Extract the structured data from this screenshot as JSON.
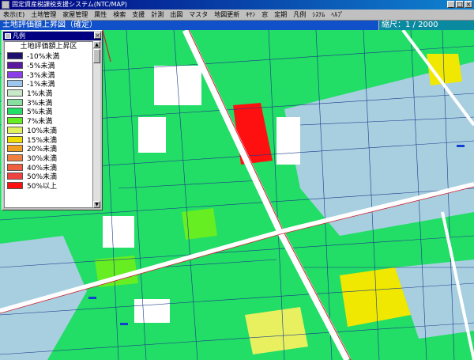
{
  "window": {
    "title": "固定資産税課税支援システム(NTC/MAP)",
    "minimize": "_",
    "maximize": "□",
    "close": "×"
  },
  "menu": [
    "表示(E)",
    "土地管理",
    "家屋管理",
    "属性",
    "検索",
    "支援",
    "計測",
    "出図",
    "マスタ",
    "地図更新",
    "ｷﾔﾝ",
    "窓",
    "定期",
    "凡例",
    "ｼｽﾃﾑ",
    "ﾍﾙﾌﾟ"
  ],
  "map_title": "土地評価額上昇図（確定）",
  "scale": "縮尺：1 / 2000",
  "legend": {
    "window_title": "凡例",
    "close": "×",
    "heading": "土地評価額上昇区",
    "items": [
      {
        "label": "-10%未満",
        "color": "#1c0f6e"
      },
      {
        "label": "-5%未満",
        "color": "#5a1aa0"
      },
      {
        "label": "-3%未満",
        "color": "#8a3fe8"
      },
      {
        "label": "-1%未満",
        "color": "#9ec7f0"
      },
      {
        "label": "1%未満",
        "color": "#c8e8c8"
      },
      {
        "label": "3%未満",
        "color": "#88e0a0"
      },
      {
        "label": "5%未満",
        "color": "#22dd66"
      },
      {
        "label": "7%未満",
        "color": "#66ee22"
      },
      {
        "label": "10%未満",
        "color": "#e0f060"
      },
      {
        "label": "15%未満",
        "color": "#f0dd00"
      },
      {
        "label": "20%未満",
        "color": "#f0a020"
      },
      {
        "label": "30%未満",
        "color": "#f08040"
      },
      {
        "label": "40%未満",
        "color": "#f06040"
      },
      {
        "label": "50%未満",
        "color": "#f04040"
      },
      {
        "label": "50%以上",
        "color": "#ff1010"
      }
    ]
  },
  "colors": {
    "road": "#ffffff",
    "road_edge": "#d02030",
    "parcel_outline": "#1a3a8a"
  }
}
